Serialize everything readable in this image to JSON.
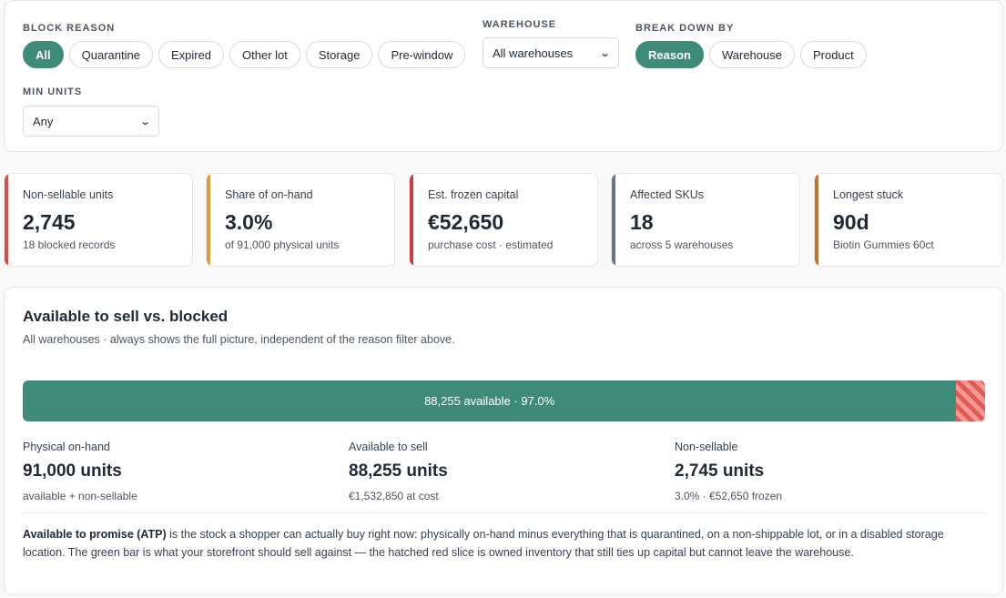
{
  "filters": {
    "block_reason": {
      "label": "BLOCK REASON",
      "options": [
        "All",
        "Quarantine",
        "Expired",
        "Other lot",
        "Storage",
        "Pre-window"
      ],
      "selected": "All"
    },
    "warehouse": {
      "label": "WAREHOUSE",
      "value": "All warehouses"
    },
    "break_down_by": {
      "label": "BREAK DOWN BY",
      "options": [
        "Reason",
        "Warehouse",
        "Product"
      ],
      "selected": "Reason"
    },
    "min_units": {
      "label": "MIN UNITS",
      "value": "Any"
    }
  },
  "kpis": [
    {
      "label": "Non-sellable units",
      "value": "2,745",
      "sub": "18 blocked records",
      "accent": "#dc4b4b"
    },
    {
      "label": "Share of on-hand",
      "value": "3.0%",
      "sub": "of 91,000 physical units",
      "accent": "#e39a3b"
    },
    {
      "label": "Est. frozen capital",
      "value": "€52,650",
      "sub": "purchase cost · estimated",
      "accent": "#cc3d3d"
    },
    {
      "label": "Affected SKUs",
      "value": "18",
      "sub": "across 5 warehouses",
      "accent": "#6b7280"
    },
    {
      "label": "Longest stuck",
      "value": "90d",
      "sub": "Biotin Gummies 60ct",
      "accent": "#b8752f"
    }
  ],
  "atp": {
    "title": "Available to sell vs. blocked",
    "subtitle": "All warehouses · always shows the full picture, independent of the reason filter above.",
    "bar_label": "88,255 available · 97.0%",
    "available_share": 0.97,
    "blocked_share": 0.03,
    "colors": {
      "available": "#3d8b78",
      "blocked": "#e35a55"
    },
    "stats": [
      {
        "label": "Physical on-hand",
        "value": "91,000 units",
        "sub": "available + non-sellable"
      },
      {
        "label": "Available to sell",
        "value": "88,255 units",
        "sub": "€1,532,850 at cost"
      },
      {
        "label": "Non-sellable",
        "value": "2,745 units",
        "sub": "3.0% · €52,650 frozen"
      }
    ],
    "note_strong": "Available to promise (ATP)",
    "note_text": " is the stock a shopper can actually buy right now: physically on-hand minus everything that is quarantined, on a non-shippable lot, or in a disabled storage location. The green bar is what your storefront should sell against — the hatched red slice is owned inventory that still ties up capital but cannot leave the warehouse."
  },
  "theme": {
    "accent": "#3d8b78"
  }
}
